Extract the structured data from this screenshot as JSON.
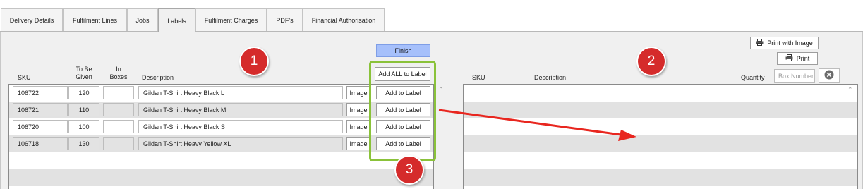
{
  "tabs": [
    {
      "label": "Delivery Details"
    },
    {
      "label": "Fulfilment Lines"
    },
    {
      "label": "Jobs"
    },
    {
      "label": "Labels"
    },
    {
      "label": "Fulfilment Charges"
    },
    {
      "label": "PDF's"
    },
    {
      "label": "Financial Authorisation"
    }
  ],
  "active_tab": "Labels",
  "left": {
    "headers": {
      "sku": "SKU",
      "to_be_given_1": "To Be",
      "to_be_given_2": "Given",
      "in_boxes_1": "In",
      "in_boxes_2": "Boxes",
      "description": "Description"
    },
    "finish_label": "Finish",
    "add_all_label": "Add ALL to Label",
    "image_label": "Image",
    "add_label": "Add to Label",
    "rows": [
      {
        "sku": "106722",
        "to_be_given": "120",
        "in_boxes": "",
        "description": "Gildan T-Shirt Heavy Black L"
      },
      {
        "sku": "106721",
        "to_be_given": "110",
        "in_boxes": "",
        "description": "Gildan T-Shirt Heavy Black M"
      },
      {
        "sku": "106720",
        "to_be_given": "100",
        "in_boxes": "",
        "description": "Gildan T-Shirt Heavy Black S"
      },
      {
        "sku": "106718",
        "to_be_given": "130",
        "in_boxes": "",
        "description": "Gildan T-Shirt Heavy Yellow XL"
      }
    ]
  },
  "right": {
    "headers": {
      "sku": "SKU",
      "description": "Description",
      "quantity": "Quantity"
    },
    "box_number_placeholder": "Box Number",
    "print_with_image_label": "Print with Image",
    "print_label": "Print"
  },
  "annotations": {
    "badge1": "1",
    "badge2": "2",
    "badge3": "3"
  },
  "colors": {
    "badge": "#d52b2b",
    "highlight": "#8ac23a",
    "finish": "#a6c0fb",
    "arrow": "#e8261f"
  },
  "icons": {
    "print": "printer-icon",
    "clear": "close-circle-icon",
    "scroll": "scroll-up-icon"
  }
}
